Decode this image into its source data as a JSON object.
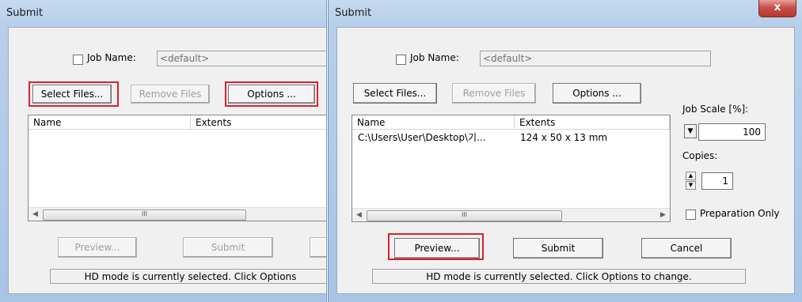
{
  "left_window": {
    "title": "Submit",
    "job_name_label": "Job Name:",
    "job_name_placeholder": "<default>",
    "buttons": {
      "select_files": "Select Files...",
      "remove_files": "Remove Files",
      "options": "Options ...",
      "preview": "Preview...",
      "submit": "Submit"
    },
    "columns": [
      "Name",
      "Extents"
    ],
    "scroll_thumb": "III",
    "status": "HD mode is currently selected. Click Options"
  },
  "right_window": {
    "title": "Submit",
    "close_glyph": "x",
    "job_name_label": "Job Name:",
    "job_name_placeholder": "<default>",
    "buttons": {
      "select_files": "Select Files...",
      "remove_files": "Remove Files",
      "options": "Options ...",
      "preview": "Preview...",
      "submit": "Submit",
      "cancel": "Cancel"
    },
    "columns": [
      "Name",
      "Extents"
    ],
    "rows": [
      {
        "name": "C:\\Users\\User\\Desktop\\기...",
        "extents": "124 x 50 x 13 mm"
      }
    ],
    "scroll_thumb": "III",
    "job_scale_label": "Job Scale [%]:",
    "job_scale_value": "100",
    "copies_label": "Copies:",
    "copies_value": "1",
    "preparation_only_label": "Preparation Only",
    "status": "HD mode is currently selected. Click Options to change."
  },
  "highlight_color": "#e0202c"
}
